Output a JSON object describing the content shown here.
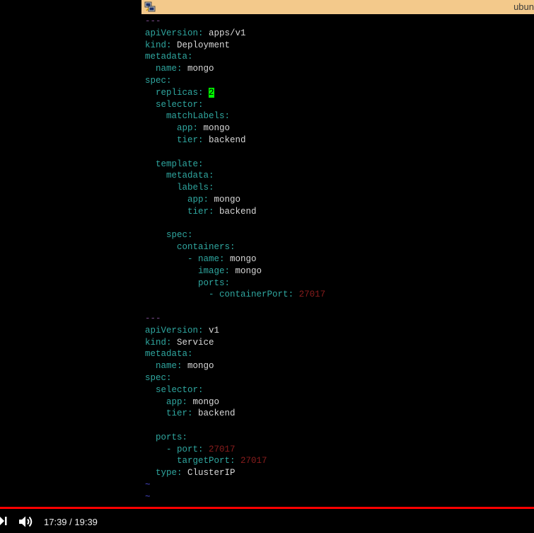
{
  "titlebar": {
    "title": "ubun"
  },
  "terminal": {
    "lines": [
      [
        {
          "t": "---",
          "c": "dash"
        }
      ],
      [
        {
          "t": "apiVersion",
          "c": "k"
        },
        {
          "t": ": ",
          "c": "k"
        },
        {
          "t": "apps/v1",
          "c": "v"
        }
      ],
      [
        {
          "t": "kind",
          "c": "k"
        },
        {
          "t": ": ",
          "c": "k"
        },
        {
          "t": "Deployment",
          "c": "v"
        }
      ],
      [
        {
          "t": "metadata",
          "c": "k"
        },
        {
          "t": ":",
          "c": "k"
        }
      ],
      [
        {
          "t": "  name",
          "c": "k"
        },
        {
          "t": ": ",
          "c": "k"
        },
        {
          "t": "mongo",
          "c": "v"
        }
      ],
      [
        {
          "t": "spec",
          "c": "k"
        },
        {
          "t": ":",
          "c": "k"
        }
      ],
      [
        {
          "t": "  replicas",
          "c": "k"
        },
        {
          "t": ": ",
          "c": "k"
        },
        {
          "t": "2",
          "c": "cursor"
        }
      ],
      [
        {
          "t": "  selector",
          "c": "k"
        },
        {
          "t": ":",
          "c": "k"
        }
      ],
      [
        {
          "t": "    matchLabels",
          "c": "k"
        },
        {
          "t": ":",
          "c": "k"
        }
      ],
      [
        {
          "t": "      app",
          "c": "k"
        },
        {
          "t": ": ",
          "c": "k"
        },
        {
          "t": "mongo",
          "c": "v"
        }
      ],
      [
        {
          "t": "      tier",
          "c": "k"
        },
        {
          "t": ": ",
          "c": "k"
        },
        {
          "t": "backend",
          "c": "v"
        }
      ],
      [],
      [
        {
          "t": "  template",
          "c": "k"
        },
        {
          "t": ":",
          "c": "k"
        }
      ],
      [
        {
          "t": "    metadata",
          "c": "k"
        },
        {
          "t": ":",
          "c": "k"
        }
      ],
      [
        {
          "t": "      labels",
          "c": "k"
        },
        {
          "t": ":",
          "c": "k"
        }
      ],
      [
        {
          "t": "        app",
          "c": "k"
        },
        {
          "t": ": ",
          "c": "k"
        },
        {
          "t": "mongo",
          "c": "v"
        }
      ],
      [
        {
          "t": "        tier",
          "c": "k"
        },
        {
          "t": ": ",
          "c": "k"
        },
        {
          "t": "backend",
          "c": "v"
        }
      ],
      [],
      [
        {
          "t": "    spec",
          "c": "k"
        },
        {
          "t": ":",
          "c": "k"
        }
      ],
      [
        {
          "t": "      containers",
          "c": "k"
        },
        {
          "t": ":",
          "c": "k"
        }
      ],
      [
        {
          "t": "        - ",
          "c": "k"
        },
        {
          "t": "name",
          "c": "k"
        },
        {
          "t": ": ",
          "c": "k"
        },
        {
          "t": "mongo",
          "c": "v"
        }
      ],
      [
        {
          "t": "          image",
          "c": "k"
        },
        {
          "t": ": ",
          "c": "k"
        },
        {
          "t": "mongo",
          "c": "v"
        }
      ],
      [
        {
          "t": "          ports",
          "c": "k"
        },
        {
          "t": ":",
          "c": "k"
        }
      ],
      [
        {
          "t": "            - ",
          "c": "k"
        },
        {
          "t": "containerPort",
          "c": "k"
        },
        {
          "t": ": ",
          "c": "k"
        },
        {
          "t": "27017",
          "c": "n"
        }
      ],
      [],
      [
        {
          "t": "---",
          "c": "dash"
        }
      ],
      [
        {
          "t": "apiVersion",
          "c": "k"
        },
        {
          "t": ": ",
          "c": "k"
        },
        {
          "t": "v1",
          "c": "v"
        }
      ],
      [
        {
          "t": "kind",
          "c": "k"
        },
        {
          "t": ": ",
          "c": "k"
        },
        {
          "t": "Service",
          "c": "v"
        }
      ],
      [
        {
          "t": "metadata",
          "c": "k"
        },
        {
          "t": ":",
          "c": "k"
        }
      ],
      [
        {
          "t": "  name",
          "c": "k"
        },
        {
          "t": ": ",
          "c": "k"
        },
        {
          "t": "mongo",
          "c": "v"
        }
      ],
      [
        {
          "t": "spec",
          "c": "k"
        },
        {
          "t": ":",
          "c": "k"
        }
      ],
      [
        {
          "t": "  selector",
          "c": "k"
        },
        {
          "t": ":",
          "c": "k"
        }
      ],
      [
        {
          "t": "    app",
          "c": "k"
        },
        {
          "t": ": ",
          "c": "k"
        },
        {
          "t": "mongo",
          "c": "v"
        }
      ],
      [
        {
          "t": "    tier",
          "c": "k"
        },
        {
          "t": ": ",
          "c": "k"
        },
        {
          "t": "backend",
          "c": "v"
        }
      ],
      [],
      [
        {
          "t": "  ports",
          "c": "k"
        },
        {
          "t": ":",
          "c": "k"
        }
      ],
      [
        {
          "t": "    - ",
          "c": "k"
        },
        {
          "t": "port",
          "c": "k"
        },
        {
          "t": ": ",
          "c": "k"
        },
        {
          "t": "27017",
          "c": "n"
        }
      ],
      [
        {
          "t": "      targetPort",
          "c": "k"
        },
        {
          "t": ": ",
          "c": "k"
        },
        {
          "t": "27017",
          "c": "n"
        }
      ],
      [
        {
          "t": "  type",
          "c": "k"
        },
        {
          "t": ": ",
          "c": "k"
        },
        {
          "t": "ClusterIP",
          "c": "v"
        }
      ],
      [
        {
          "t": "~",
          "c": "tilde"
        }
      ],
      [
        {
          "t": "~",
          "c": "tilde"
        }
      ],
      [
        {
          "t": "~",
          "c": "tilde"
        }
      ],
      [
        {
          "t": "~",
          "c": "tilde"
        }
      ]
    ]
  },
  "player": {
    "time_display": "17:39 / 19:39",
    "progress_fraction": 0.905,
    "icons": [
      "next-icon",
      "volume-icon"
    ]
  },
  "colors": {
    "titlebar": "#f3c98b",
    "key": "#2fa7a0",
    "value": "#d8d8d8",
    "number": "#8a1d1d",
    "cursor": "#00ff00",
    "progress": "#ff0000"
  }
}
